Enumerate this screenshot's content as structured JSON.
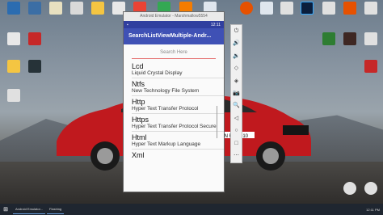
{
  "desktop": {
    "icons": [
      {
        "label": "",
        "color": "#2b6cb0"
      },
      {
        "label": "",
        "color": "#3b6ea5"
      },
      {
        "label": "",
        "color": "#e8e0c0"
      },
      {
        "label": "",
        "color": "#d9d9d9"
      },
      {
        "label": "",
        "color": "#f4c542"
      },
      {
        "label": "",
        "color": "#e8e8e8"
      },
      {
        "label": "",
        "color": "#ea4335"
      },
      {
        "label": "",
        "color": "#34a853"
      },
      {
        "label": "",
        "color": "#f57c00"
      },
      {
        "label": "",
        "color": "#dfe6ee"
      },
      {
        "label": "",
        "color": "#31a8ff"
      },
      {
        "label": "",
        "color": "#e8e8e8"
      },
      {
        "label": "",
        "color": "#e65100"
      },
      {
        "label": "",
        "color": "#e0e0e0"
      },
      {
        "label": "",
        "color": "#e0e0e0"
      },
      {
        "label": "",
        "color": "#2e7d32"
      },
      {
        "label": "",
        "color": "#3e2723"
      },
      {
        "label": "",
        "color": "#e0e0e0"
      },
      {
        "label": "",
        "color": "#263238"
      },
      {
        "label": "",
        "color": "#c62828"
      },
      {
        "label": "",
        "color": "#e0e0e0"
      }
    ]
  },
  "emulator": {
    "window_title": "Android Emulator - Marshmallow5554",
    "status_time": "12:11",
    "app_title": "SearchListViewMultiple-Andr...",
    "search_placeholder": "Search Here",
    "items": [
      {
        "title": "Lcd",
        "desc": "Liquid Crystal Display"
      },
      {
        "title": "Ntfs",
        "desc": "New Technology File System"
      },
      {
        "title": "Http",
        "desc": "Hyper Text Transfer Protocol"
      },
      {
        "title": "Https",
        "desc": "Hyper Text Transfer Protocol Secure"
      },
      {
        "title": "Html",
        "desc": "Hyper Text Markup Language"
      },
      {
        "title": "Xml",
        "desc": ""
      }
    ],
    "tools": [
      "⏻",
      "🔊",
      "🔉",
      "◇",
      "◈",
      "📷",
      "🔍",
      "◁",
      "○",
      "□",
      "⋯"
    ]
  },
  "car": {
    "plate": "IN RS 3010"
  },
  "taskbar": {
    "start_icon": "windows-icon",
    "apps": [
      "Android Emulator...",
      "Flashing"
    ],
    "time": "12:11 PM"
  }
}
